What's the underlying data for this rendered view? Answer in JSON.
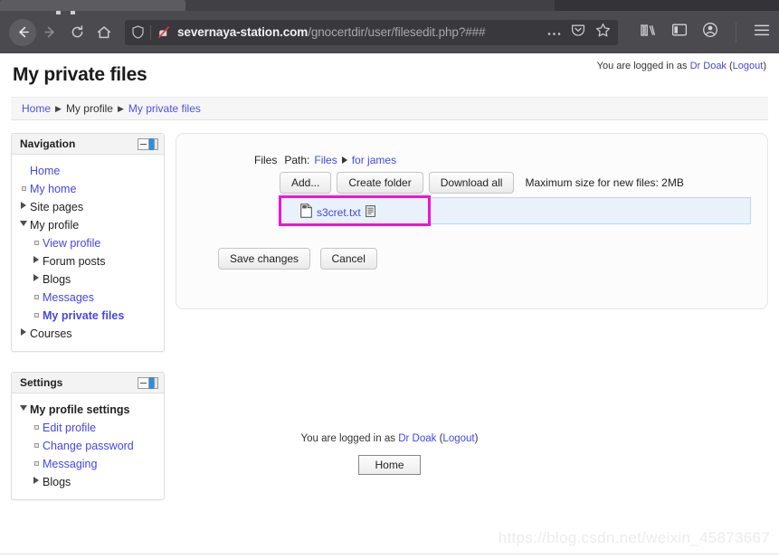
{
  "browser": {
    "url_host": "severnaya-station.com",
    "url_path": "/gnocertdir/user/filesedit.php?###",
    "icons": {
      "back": "back-arrow-icon",
      "forward": "forward-arrow-icon",
      "reload": "reload-icon",
      "home": "home-icon",
      "shield": "tracking-protection-shield-icon",
      "lock": "insecure-connection-icon",
      "ellipsis": "page-actions-icon",
      "pocket": "pocket-icon",
      "star": "bookmark-star-icon",
      "library": "library-icon",
      "sidebar": "sidebar-icon",
      "account": "account-icon",
      "menu": "hamburger-menu-icon"
    }
  },
  "header": {
    "title": "My private files",
    "login_prefix": "You are logged in as",
    "login_user": "Dr Doak",
    "logout_open": "(",
    "logout_label": "Logout",
    "logout_close": ")"
  },
  "breadcrumb": {
    "items": [
      "Home",
      "My profile",
      "My private files"
    ],
    "separator": "▶"
  },
  "blocks": [
    {
      "title": "Navigation",
      "items": [
        {
          "label": "Home",
          "marker": "none",
          "indent": 0,
          "link": true,
          "bold": false
        },
        {
          "label": "My home",
          "marker": "square",
          "indent": 0,
          "link": true,
          "bold": false
        },
        {
          "label": "Site pages",
          "marker": "collapsed",
          "indent": 0,
          "link": false,
          "bold": false
        },
        {
          "label": "My profile",
          "marker": "expanded",
          "indent": 0,
          "link": false,
          "bold": false
        },
        {
          "label": "View profile",
          "marker": "square",
          "indent": 1,
          "link": true,
          "bold": false
        },
        {
          "label": "Forum posts",
          "marker": "collapsed",
          "indent": 1,
          "link": false,
          "bold": false
        },
        {
          "label": "Blogs",
          "marker": "collapsed",
          "indent": 1,
          "link": false,
          "bold": false
        },
        {
          "label": "Messages",
          "marker": "square",
          "indent": 1,
          "link": true,
          "bold": false
        },
        {
          "label": "My private files",
          "marker": "square",
          "indent": 1,
          "link": true,
          "bold": true
        },
        {
          "label": "Courses",
          "marker": "collapsed",
          "indent": 0,
          "link": false,
          "bold": false
        }
      ]
    },
    {
      "title": "Settings",
      "items": [
        {
          "label": "My profile settings",
          "marker": "expanded",
          "indent": 0,
          "link": false,
          "bold": true
        },
        {
          "label": "Edit profile",
          "marker": "square",
          "indent": 1,
          "link": true,
          "bold": false
        },
        {
          "label": "Change password",
          "marker": "square",
          "indent": 1,
          "link": true,
          "bold": false
        },
        {
          "label": "Messaging",
          "marker": "square",
          "indent": 1,
          "link": true,
          "bold": false
        },
        {
          "label": "Blogs",
          "marker": "collapsed",
          "indent": 1,
          "link": false,
          "bold": false
        }
      ]
    }
  ],
  "filemanager": {
    "field_label": "Files",
    "path_label": "Path:",
    "path_root": "Files",
    "path_current": "for james",
    "buttons": {
      "add": "Add...",
      "create_folder": "Create folder",
      "download_all": "Download all"
    },
    "max_size_note": "Maximum size for new files: 2MB",
    "files": [
      {
        "name": "s3cret.txt",
        "icon": "text-file-icon",
        "detail_icon": "file-details-icon",
        "highlighted": true
      }
    ],
    "highlight_color": "#f013d4"
  },
  "form": {
    "save_label": "Save changes",
    "cancel_label": "Cancel"
  },
  "footer": {
    "login_prefix": "You are logged in as",
    "login_user": "Dr Doak",
    "logout_open": "(",
    "logout_label": "Logout",
    "logout_close": ")",
    "home_button": "Home"
  },
  "watermark": "https://blog.csdn.net/weixin_45873667"
}
